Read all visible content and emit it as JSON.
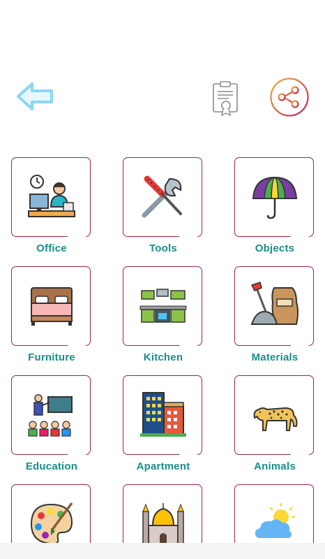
{
  "header": {
    "back_icon": "arrow-left-icon",
    "certificate_icon": "certificate-icon",
    "share_icon": "share-icon",
    "colors": {
      "back_glow": "#4fc3f7",
      "share_gradient_start": "#f3b13c",
      "share_gradient_end": "#c2185b"
    }
  },
  "categories": [
    {
      "label": "Office",
      "icon": "office-worker-icon"
    },
    {
      "label": "Tools",
      "icon": "tools-icon"
    },
    {
      "label": "Objects",
      "icon": "umbrella-icon"
    },
    {
      "label": "Furniture",
      "icon": "bed-icon"
    },
    {
      "label": "Kitchen",
      "icon": "kitchen-icon"
    },
    {
      "label": "Materials",
      "icon": "materials-icon"
    },
    {
      "label": "Education",
      "icon": "classroom-icon"
    },
    {
      "label": "Apartment",
      "icon": "apartment-icon"
    },
    {
      "label": "Animals",
      "icon": "leopard-icon"
    },
    {
      "label": "",
      "icon": "palette-icon"
    },
    {
      "label": "",
      "icon": "mosque-icon"
    },
    {
      "label": "",
      "icon": "weather-icon"
    }
  ],
  "colors": {
    "tile_border": "#9b2544",
    "label": "#15908a"
  }
}
